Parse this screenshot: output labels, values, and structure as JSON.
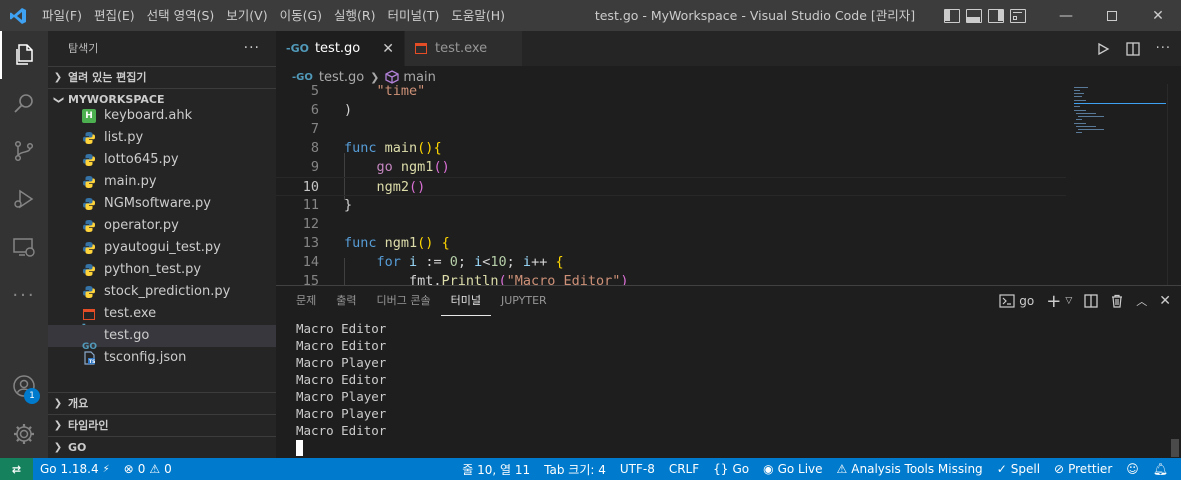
{
  "titlebar": {
    "menus": [
      "파일(F)",
      "편집(E)",
      "선택 영역(S)",
      "보기(V)",
      "이동(G)",
      "실행(R)",
      "터미널(T)",
      "도움말(H)"
    ],
    "window_title": "test.go - MyWorkspace - Visual Studio Code [관리자]"
  },
  "activitybar": {
    "items": [
      "explorer-icon",
      "search-icon",
      "source-control-icon",
      "run-debug-icon",
      "remote-explorer-icon",
      "more-icon"
    ],
    "accounts_badge": "1"
  },
  "sidebar": {
    "title": "탐색기",
    "more": "···",
    "open_editors": "열려 있는 편집기",
    "workspace": "MYWORKSPACE",
    "files": [
      {
        "name": "keyboard.ahk",
        "icon": "ahk-icon",
        "color": "#4caf50"
      },
      {
        "name": "list.py",
        "icon": "python-icon",
        "color": "#3572a5"
      },
      {
        "name": "lotto645.py",
        "icon": "python-icon",
        "color": "#3572a5"
      },
      {
        "name": "main.py",
        "icon": "python-icon",
        "color": "#3572a5"
      },
      {
        "name": "NGMsoftware.py",
        "icon": "python-icon",
        "color": "#3572a5"
      },
      {
        "name": "operator.py",
        "icon": "python-icon",
        "color": "#3572a5"
      },
      {
        "name": "pyautogui_test.py",
        "icon": "python-icon",
        "color": "#3572a5"
      },
      {
        "name": "python_test.py",
        "icon": "python-icon",
        "color": "#3572a5"
      },
      {
        "name": "stock_prediction.py",
        "icon": "python-icon",
        "color": "#3572a5"
      },
      {
        "name": "test.exe",
        "icon": "exe-icon",
        "color": "#e44d26"
      },
      {
        "name": "test.go",
        "icon": "go-icon",
        "color": "#519aba",
        "selected": true
      },
      {
        "name": "tsconfig.json",
        "icon": "tsconfig-icon",
        "color": "#3178c6"
      }
    ],
    "outline": "개요",
    "timeline": "타임라인",
    "go": "GO"
  },
  "tabs": [
    {
      "label": "test.go",
      "icon": "go-icon",
      "active": true,
      "close": "✕"
    },
    {
      "label": "test.exe",
      "icon": "exe-icon",
      "active": false
    }
  ],
  "breadcrumb": {
    "file": "test.go",
    "symbol": "main"
  },
  "editor": {
    "current_line": 10,
    "lines": [
      {
        "n": "5",
        "code": "    \"time\""
      },
      {
        "n": "6",
        "code": ")"
      },
      {
        "n": "7",
        "code": ""
      },
      {
        "n": "8",
        "code": "func main(){"
      },
      {
        "n": "9",
        "code": "    go ngm1()"
      },
      {
        "n": "10",
        "code": "    ngm2()"
      },
      {
        "n": "11",
        "code": "}"
      },
      {
        "n": "12",
        "code": ""
      },
      {
        "n": "13",
        "code": "func ngm1() {"
      },
      {
        "n": "14",
        "code": "    for i := 0; i<10; i++ {"
      },
      {
        "n": "15",
        "code": "        fmt.Println(\"Macro Editor\")"
      }
    ]
  },
  "panel": {
    "tabs": [
      "문제",
      "출력",
      "디버그 콘솔",
      "터미널",
      "JUPYTER"
    ],
    "active_tab": "터미널",
    "terminal_name": "go",
    "terminal_lines": [
      "Macro Editor",
      "Macro Editor",
      "Macro Player",
      "Macro Editor",
      "Macro Player",
      "Macro Player",
      "Macro Editor"
    ]
  },
  "statusbar": {
    "go_version": "Go 1.18.4",
    "errors": "0",
    "warnings": "0",
    "position": "줄 10, 열 11",
    "tab_size": "Tab 크기: 4",
    "encoding": "UTF-8",
    "eol": "CRLF",
    "language": "Go",
    "go_live": "Go Live",
    "analysis": "Analysis Tools Missing",
    "spell": "Spell",
    "prettier": "Prettier"
  },
  "colors": {
    "accent": "#007acc",
    "remote": "#16825d",
    "titlebar": "#3c3c3c",
    "sidebar": "#252526",
    "editor": "#1e1e1e"
  }
}
